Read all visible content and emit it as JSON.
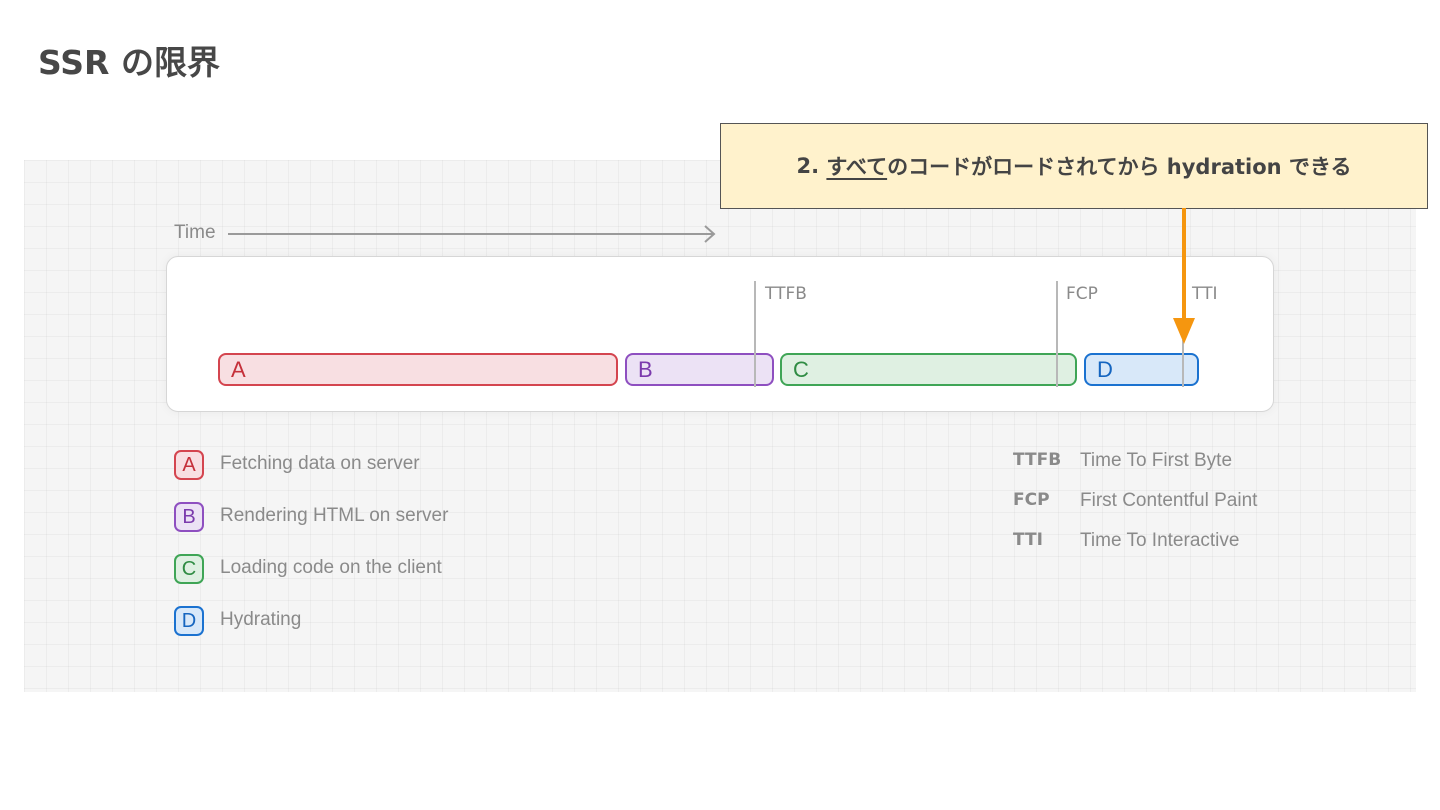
{
  "title": "SSR の限界",
  "timeline": {
    "time_label": "Time",
    "bars": [
      {
        "key": "A",
        "color": "#d4454f"
      },
      {
        "key": "B",
        "color": "#8e4fc0"
      },
      {
        "key": "C",
        "color": "#3fa556"
      },
      {
        "key": "D",
        "color": "#1b72d0"
      }
    ],
    "markers": [
      "TTFB",
      "FCP",
      "TTI"
    ]
  },
  "legend": [
    {
      "key": "A",
      "label": "Fetching data on server"
    },
    {
      "key": "B",
      "label": "Rendering HTML on server"
    },
    {
      "key": "C",
      "label": "Loading code on the client"
    },
    {
      "key": "D",
      "label": "Hydrating"
    }
  ],
  "abbreviations": [
    {
      "term": "TTFB",
      "definition": "Time To First Byte"
    },
    {
      "term": "FCP",
      "definition": "First Contentful Paint"
    },
    {
      "term": "TTI",
      "definition": "Time To Interactive"
    }
  ],
  "callout": {
    "prefix": "2. ",
    "underlined": "すべて",
    "rest": "のコードがロードされてから hydration できる",
    "background": "#fff2cc",
    "arrow_color": "#f5960f"
  }
}
